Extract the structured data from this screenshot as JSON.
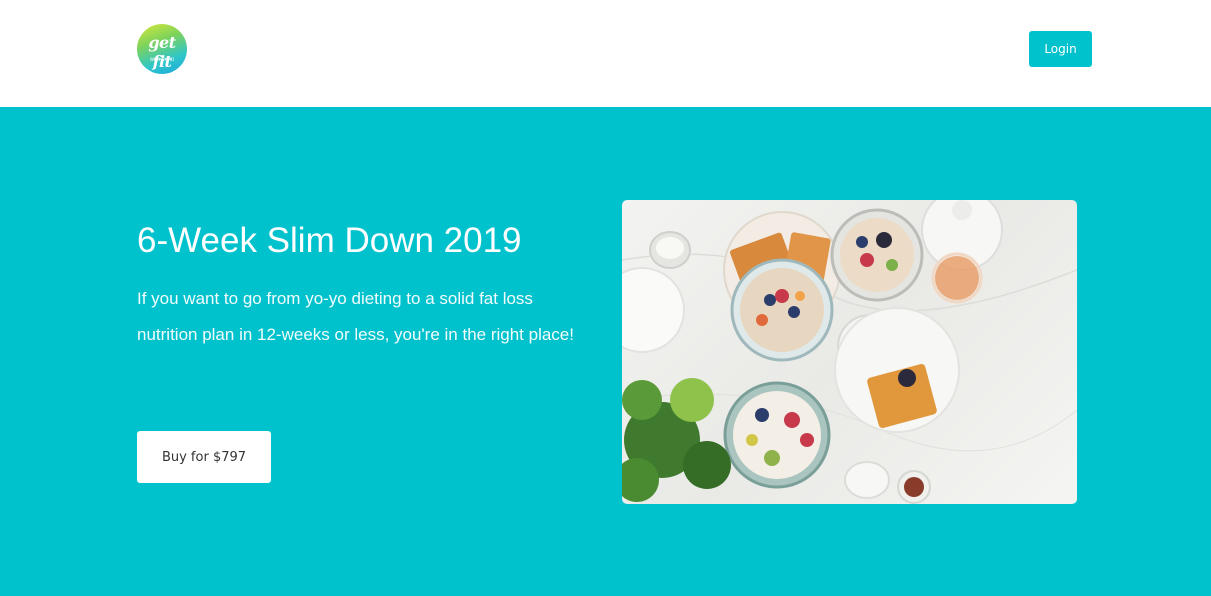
{
  "header": {
    "logo_text": "get fit",
    "logo_subtext": "WITH DAVID",
    "login_label": "Login"
  },
  "hero": {
    "title": "6-Week Slim Down 2019",
    "description": "If you want to go from yo-yo dieting to a solid fat loss nutrition plan in 12-weeks or less, you're in the right place!",
    "buy_label": "Buy for $797"
  },
  "colors": {
    "accent": "#00c2cd",
    "button_text": "#333333",
    "background": "#ffffff"
  }
}
